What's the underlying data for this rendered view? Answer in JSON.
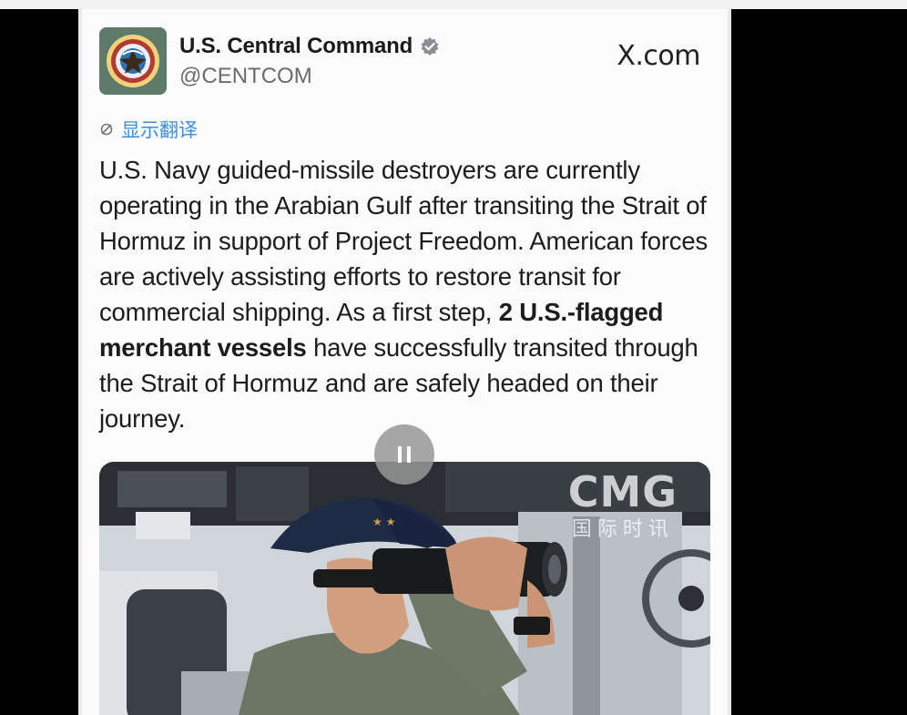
{
  "post": {
    "author_name": "U.S. Central Command",
    "handle": "@CENTCOM",
    "site": "X.com",
    "translate_label": "显示翻译",
    "text_part1": "U.S. Navy guided-missile destroyers are currently operating in the Arabian Gulf after transiting the Strait of Hormuz in support of Project Freedom. American forces are actively assisting efforts to restore transit for commercial shipping. As a first step, ",
    "text_bold": "2 U.S.-flagged merchant vessels",
    "text_part2": " have successfully transited through the Strait of Hormuz and are safely headed on their journey."
  },
  "video": {
    "watermark_logo": "CMG",
    "watermark_sub": "国际时讯"
  },
  "icons": {
    "verified": "verified-badge-icon",
    "translate": "translate-icon",
    "pause": "pause-icon"
  },
  "colors": {
    "translate_link": "#3b8fd6",
    "background_frame": "#000000",
    "card": "#fbfbfb"
  }
}
